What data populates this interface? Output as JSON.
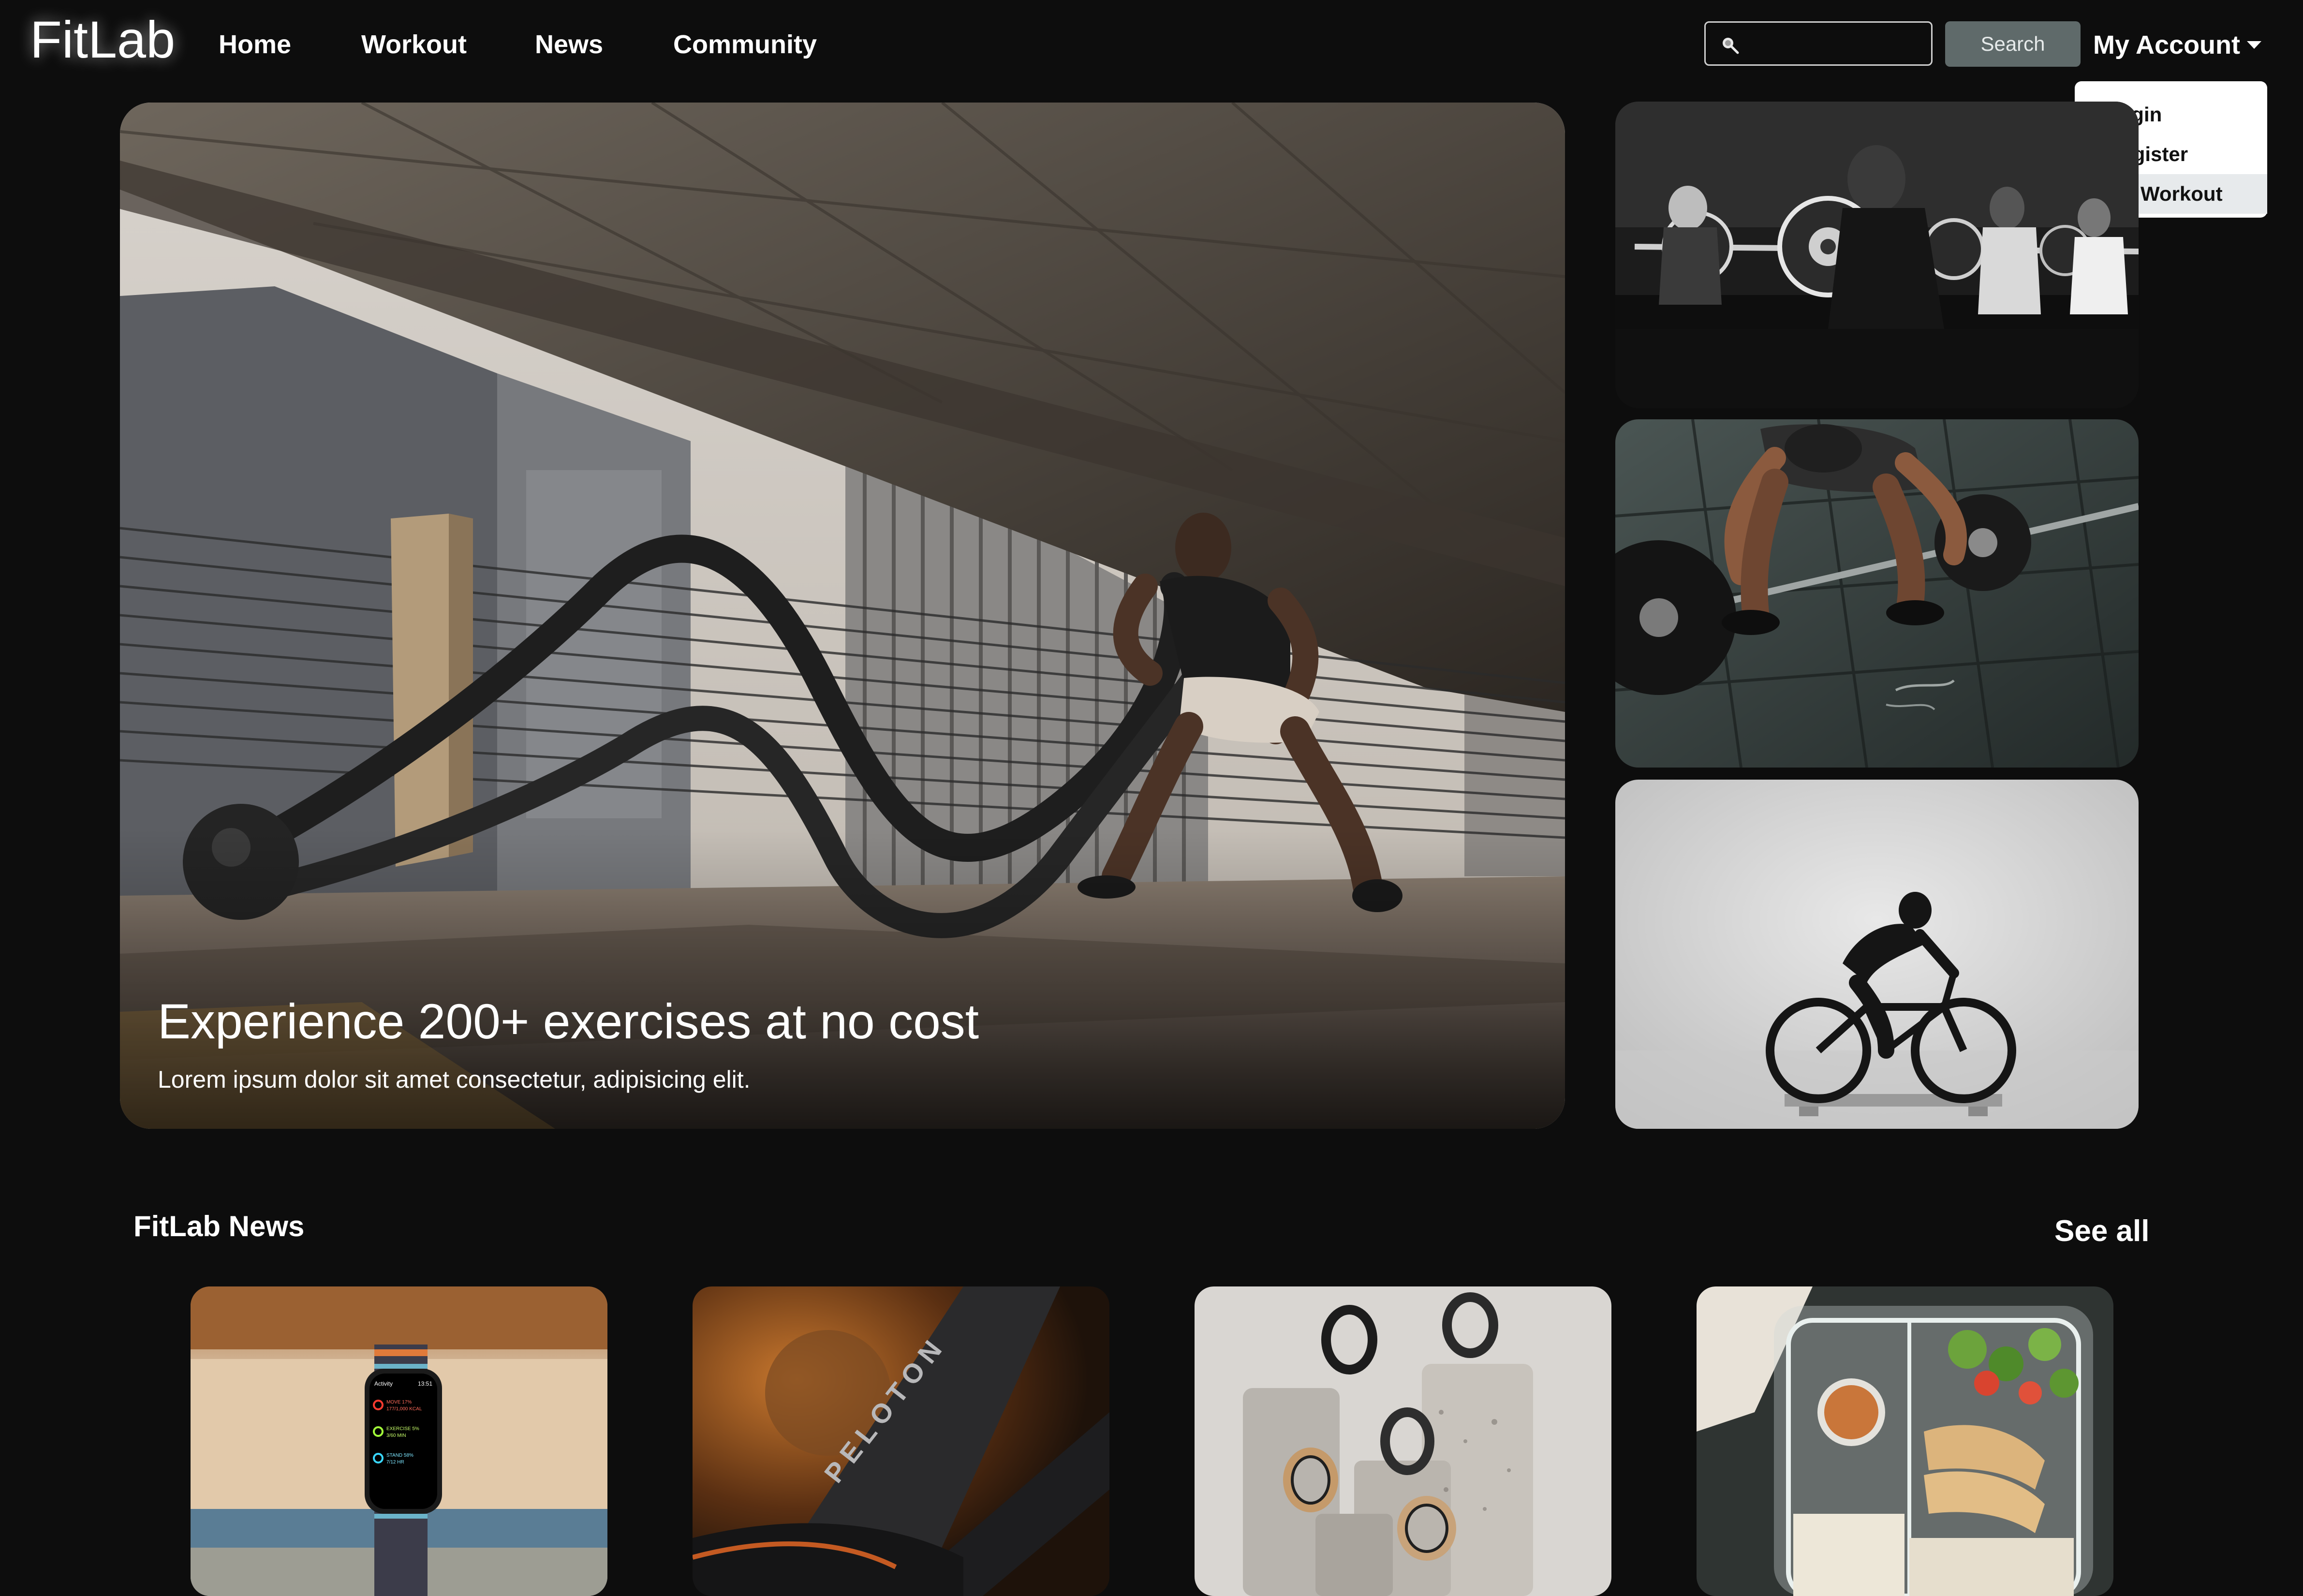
{
  "brand": "FitLab",
  "nav": {
    "home": "Home",
    "workout": "Workout",
    "news": "News",
    "community": "Community"
  },
  "search": {
    "value": "",
    "placeholder": "",
    "button_label": "Search"
  },
  "account": {
    "label": "My Account",
    "menu": [
      {
        "label": "Login"
      },
      {
        "label": "Register"
      },
      {
        "label": "My Workout"
      }
    ]
  },
  "hero": {
    "title": "Experience 200+ exercises at no cost",
    "subtitle": "Lorem ipsum dolor sit amet consectetur, adipisicing elit."
  },
  "news": {
    "heading": "FitLab News",
    "see_all": "See all",
    "watch_screen": {
      "app": "Activity",
      "time": "13:51",
      "move": "MOVE 17%",
      "move_value": "177/1,000 KCAL",
      "exercise": "EXERCISE 5%",
      "exercise_value": "3/60 MIN",
      "stand": "STAND 58%",
      "stand_value": "7/12 HR"
    },
    "bike_brand": "PELOTON"
  },
  "colors": {
    "background": "#0d0d0d",
    "search_button": "#5f6a6a",
    "dropdown_active": "#e7eaec"
  }
}
